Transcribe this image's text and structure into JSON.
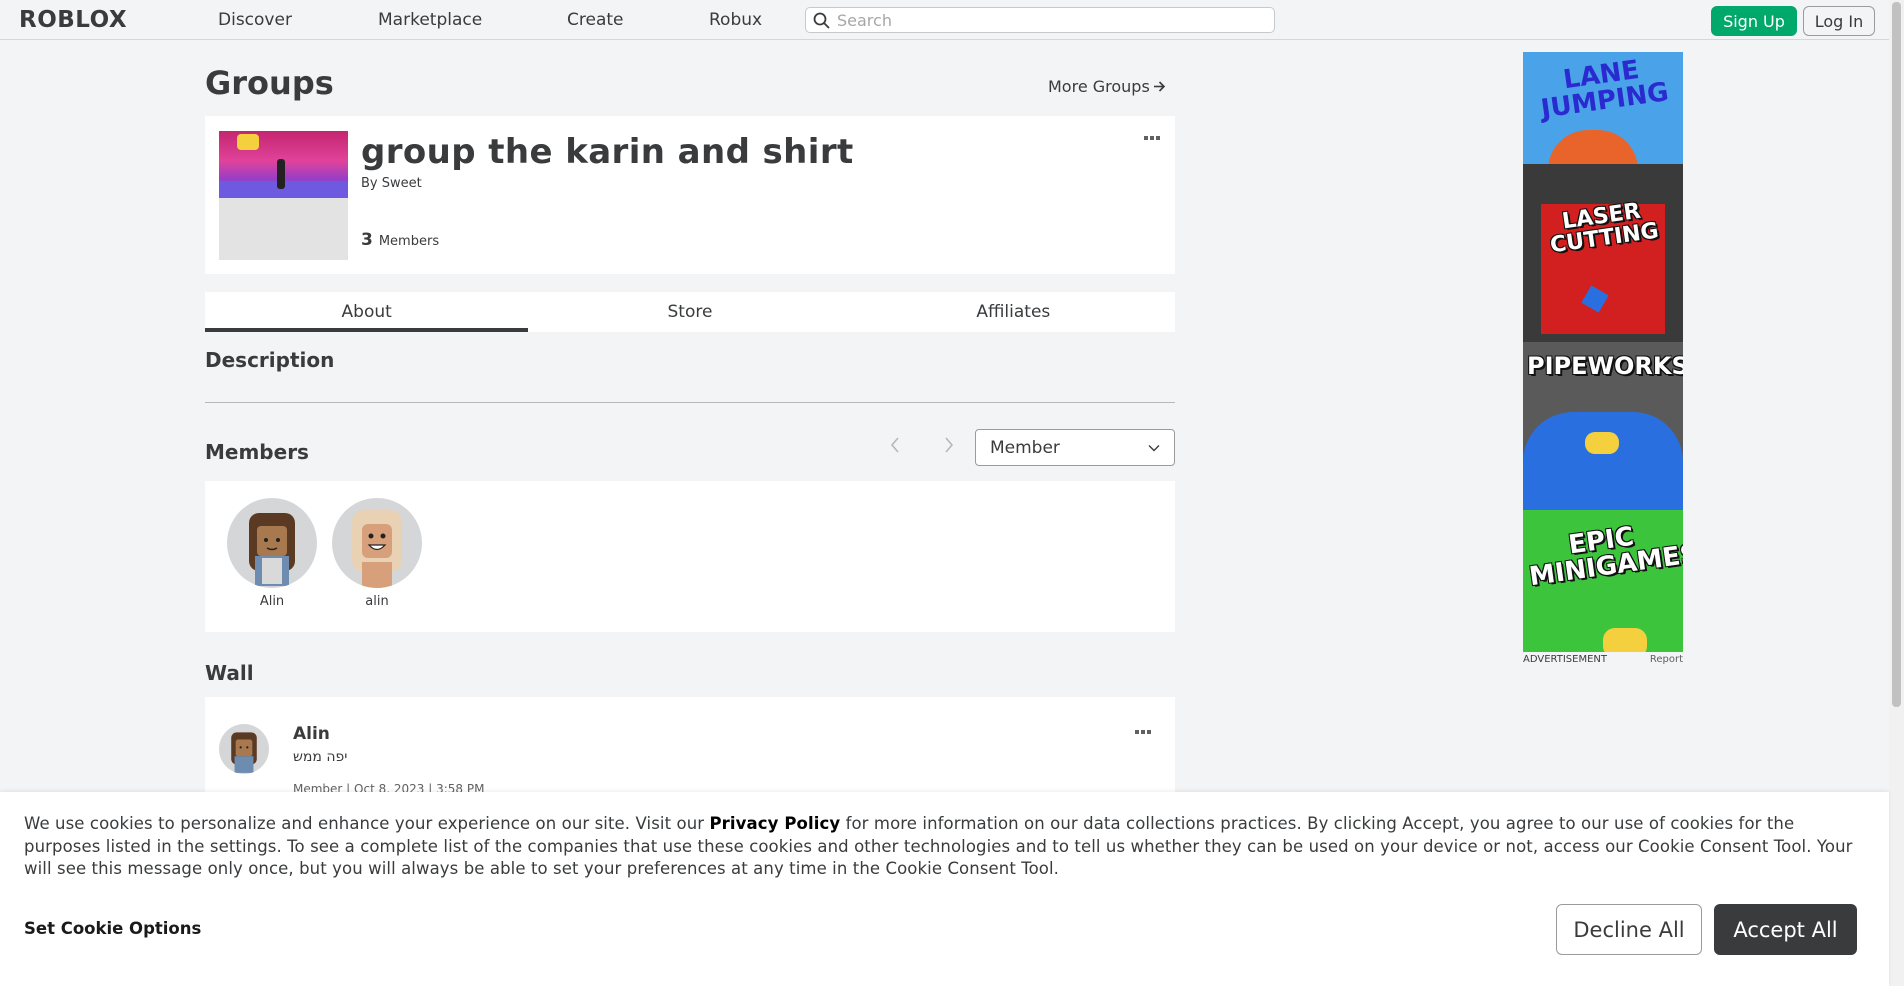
{
  "header": {
    "logo": "ROBLOX",
    "nav": [
      "Discover",
      "Marketplace",
      "Create",
      "Robux"
    ],
    "search_placeholder": "Search",
    "signup_label": "Sign Up",
    "login_label": "Log In",
    "accent": "#00a86b"
  },
  "page": {
    "title": "Groups",
    "more_groups": "More Groups"
  },
  "group": {
    "name": "group the karin and shirt",
    "by_label": "By",
    "owner": "Sweet",
    "member_count": "3",
    "members_label": "Members"
  },
  "tabs": [
    "About",
    "Store",
    "Affiliates"
  ],
  "about": {
    "description_title": "Description",
    "members_title": "Members",
    "role_selected": "Member",
    "members": [
      {
        "name": "Alin"
      },
      {
        "name": "alin"
      }
    ]
  },
  "wall": {
    "title": "Wall",
    "post": {
      "author": "Alin",
      "body": "יפה ממש",
      "meta": "Member | Oct 8, 2023 | 3:58 PM"
    }
  },
  "ad": {
    "panels": [
      "LANE JUMPING",
      "LASER CUTTING",
      "PIPEWORKS",
      "EPIC MINIGAMES"
    ],
    "label": "ADVERTISEMENT",
    "report": "Report"
  },
  "cookie": {
    "text_before": "We use cookies to personalize and enhance your experience on our site. Visit our ",
    "privacy_link": "Privacy Policy",
    "text_after": " for more information on our data collections practices. By clicking Accept, you agree to our use of cookies for the purposes listed in the settings. To see a complete list of the companies that use these cookies and other technologies and to tell us whether they can be used on your device or not, access our Cookie Consent Tool. Your will see this message only once, but you will always be able to set your preferences at any time in the Cookie Consent Tool.",
    "options_label": "Set Cookie Options",
    "decline_label": "Decline All",
    "accept_label": "Accept All"
  }
}
